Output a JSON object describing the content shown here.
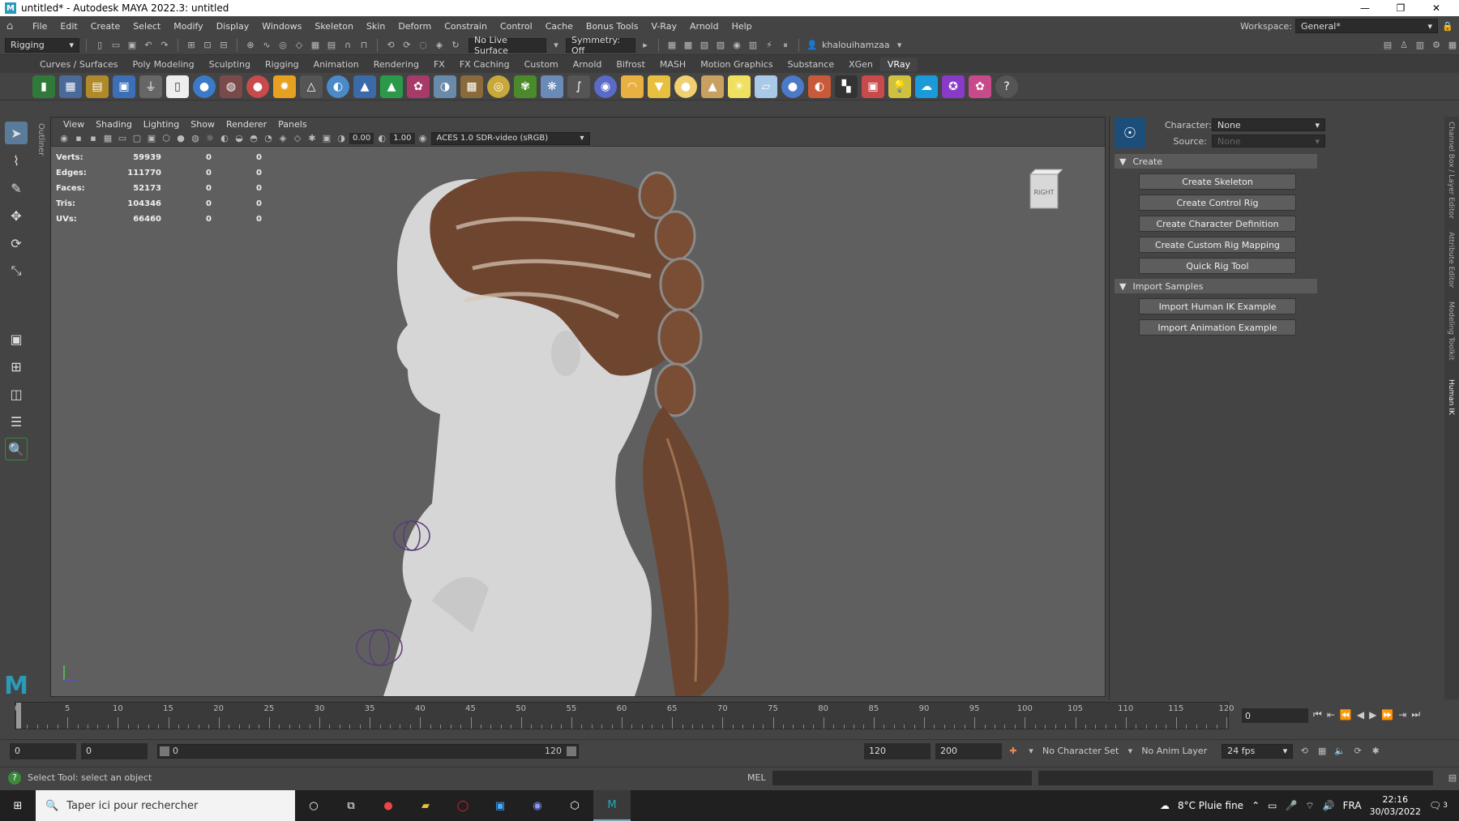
{
  "titlebar": {
    "title": "untitled* - Autodesk MAYA 2022.3: untitled",
    "logo": "M"
  },
  "menu": {
    "items": [
      "File",
      "Edit",
      "Create",
      "Select",
      "Modify",
      "Display",
      "Windows",
      "Skeleton",
      "Skin",
      "Deform",
      "Constrain",
      "Control",
      "Cache",
      "Bonus Tools",
      "V-Ray",
      "Arnold",
      "Help"
    ],
    "workspace_label": "Workspace:",
    "workspace_value": "General*"
  },
  "statusline": {
    "menuset": "Rigging",
    "live_surface": "No Live Surface",
    "symmetry": "Symmetry: Off",
    "user": "khalouihamzaa"
  },
  "shelf": {
    "tabs": [
      "Curves / Surfaces",
      "Poly Modeling",
      "Sculpting",
      "Rigging",
      "Animation",
      "Rendering",
      "FX",
      "FX Caching",
      "Custom",
      "Arnold",
      "Bifrost",
      "MASH",
      "Motion Graphics",
      "Substance",
      "XGen",
      "VRay"
    ],
    "active_tab": "VRay"
  },
  "outliner_tab": "Outliner",
  "viewport": {
    "menu": [
      "View",
      "Shading",
      "Lighting",
      "Show",
      "Renderer",
      "Panels"
    ],
    "exposure": "0.00",
    "gamma": "1.00",
    "colorspace": "ACES 1.0 SDR-video (sRGB)",
    "viewcube_label": "RIGHT",
    "hud": [
      {
        "label": "Verts:",
        "value": "59939",
        "a": "0",
        "b": "0"
      },
      {
        "label": "Edges:",
        "value": "111770",
        "a": "0",
        "b": "0"
      },
      {
        "label": "Faces:",
        "value": "52173",
        "a": "0",
        "b": "0"
      },
      {
        "label": "Tris:",
        "value": "104346",
        "a": "0",
        "b": "0"
      },
      {
        "label": "UVs:",
        "value": "66460",
        "a": "0",
        "b": "0"
      }
    ]
  },
  "humanik": {
    "character_label": "Character:",
    "character_value": "None",
    "source_label": "Source:",
    "source_value": "None",
    "create_section": "Create",
    "create_buttons": [
      "Create Skeleton",
      "Create Control Rig",
      "Create Character Definition",
      "Create Custom Rig Mapping",
      "Quick Rig Tool"
    ],
    "import_section": "Import Samples",
    "import_buttons": [
      "Import Human IK Example",
      "Import Animation Example"
    ]
  },
  "right_tabs": [
    "Channel Box / Layer Editor",
    "Attribute Editor",
    "Modeling Toolkit",
    "Human IK"
  ],
  "timeline": {
    "start": 0,
    "end": 120,
    "labels": [
      "0",
      "5",
      "10",
      "15",
      "20",
      "25",
      "30",
      "35",
      "40",
      "45",
      "50",
      "55",
      "60",
      "65",
      "70",
      "75",
      "80",
      "85",
      "90",
      "95",
      "100",
      "105",
      "110",
      "115",
      "120"
    ],
    "current_frame": "0"
  },
  "range": {
    "start": "0",
    "playback_start": "0",
    "slider_start": "0",
    "slider_end": "120",
    "playback_end": "120",
    "end": "200",
    "character_set": "No Character Set",
    "anim_layer": "No Anim Layer",
    "fps": "24 fps"
  },
  "cmdline": {
    "help": "Select Tool: select an object",
    "lang": "MEL"
  },
  "taskbar": {
    "search_placeholder": "Taper ici pour rechercher",
    "weather": "8°C Pluie fine",
    "lang": "FRA",
    "time": "22:16",
    "date": "30/03/2022",
    "notifications": "3"
  }
}
